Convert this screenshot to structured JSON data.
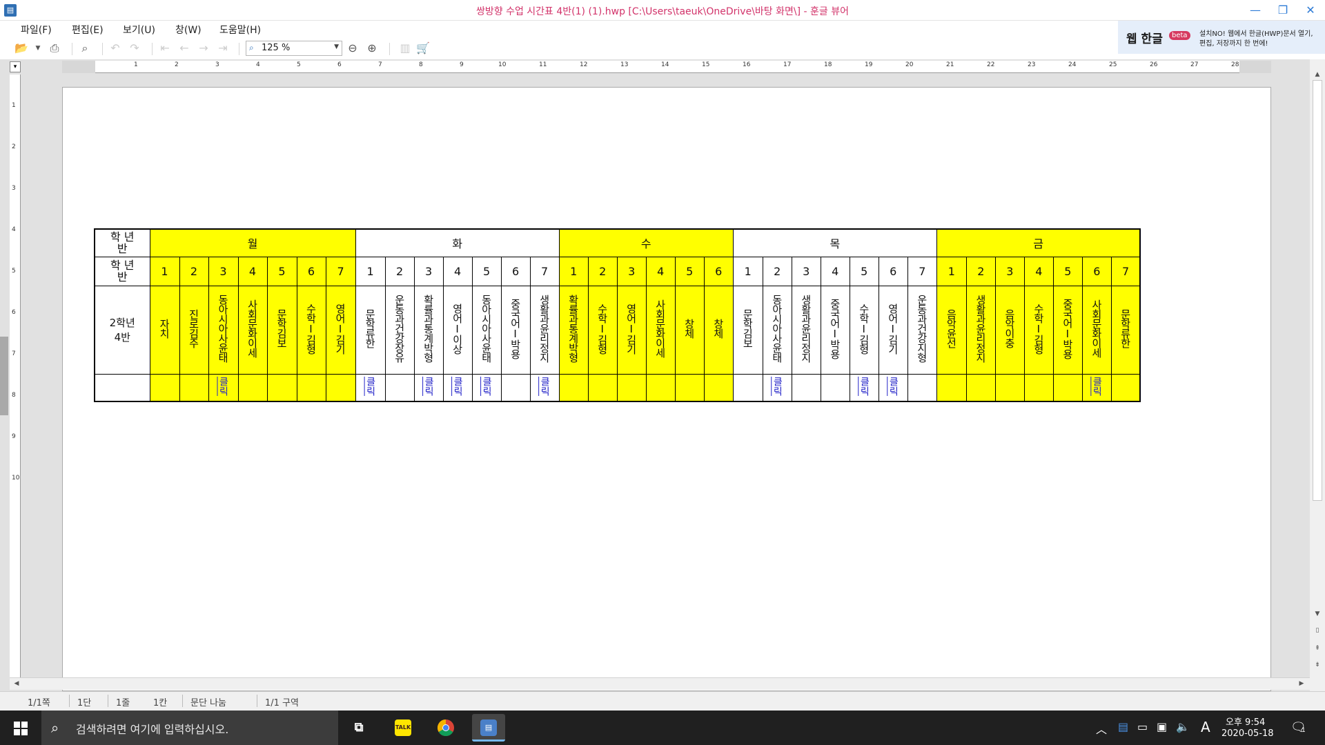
{
  "window": {
    "title": "쌍방향 수업 시간표 4반(1) (1).hwp [C:\\Users\\taeuk\\OneDrive\\바탕 화면\\] - 훈글 뷰어",
    "app_icon": "hwp-icon",
    "minimize": "—",
    "maximize": "❐",
    "close": "✕"
  },
  "menu": [
    "파일(F)",
    "편집(E)",
    "보기(U)",
    "창(W)",
    "도움말(H)"
  ],
  "toolbar": {
    "zoom": "125 %"
  },
  "promo": {
    "title": "웹 한글",
    "badge": "beta",
    "line1": "설치NO! 웹에서 한글(HWP)문서 열기,",
    "line2": "편집, 저장까지 한 번에!"
  },
  "ruler": {
    "h": [
      "1",
      "2",
      "3",
      "4",
      "5",
      "6",
      "7",
      "8",
      "9",
      "10",
      "11",
      "12",
      "13",
      "14",
      "15",
      "16",
      "17",
      "18",
      "19",
      "20",
      "21",
      "22",
      "23",
      "24",
      "25",
      "26",
      "27",
      "28"
    ],
    "v": [
      "1",
      "2",
      "3",
      "4",
      "5",
      "6",
      "7",
      "8",
      "9",
      "10"
    ]
  },
  "timetable": {
    "corner_label": "학 년\n반",
    "class_label": "2학년\n4반",
    "days": [
      {
        "name": "월",
        "color": "#ffff00",
        "periods": [
          "1",
          "2",
          "3",
          "4",
          "5",
          "6",
          "7"
        ],
        "subjects": [
          "자치",
          "진로김주",
          "동아시아사윤태",
          "사회문화이세",
          "문학김보",
          "수학I김형",
          "영어I김기"
        ],
        "links": [
          "",
          "",
          "클릭",
          "",
          "",
          "",
          ""
        ]
      },
      {
        "name": "화",
        "color": "#ffffff",
        "periods": [
          "1",
          "2",
          "3",
          "4",
          "5",
          "6",
          "7"
        ],
        "subjects": [
          "문학류한",
          "운동과건강장유",
          "확률과통계박형",
          "영어I이상",
          "동아시아사윤태",
          "중국어I박용",
          "생활과윤리정지"
        ],
        "links": [
          "클릭",
          "",
          "클릭",
          "클릭",
          "클릭",
          "",
          "클릭"
        ]
      },
      {
        "name": "수",
        "color": "#ffff00",
        "periods": [
          "1",
          "2",
          "3",
          "4",
          "5",
          "6"
        ],
        "subjects": [
          "확률과통계박형",
          "수학I김형",
          "영어I김기",
          "사회문화이세",
          "창체",
          "창체"
        ],
        "links": [
          "",
          "",
          "",
          "",
          "",
          ""
        ]
      },
      {
        "name": "목",
        "color": "#ffffff",
        "periods": [
          "1",
          "2",
          "3",
          "4",
          "5",
          "6",
          "7"
        ],
        "subjects": [
          "문학김보",
          "동아시아사윤태",
          "생활과윤리정지",
          "중국어I박용",
          "수학I김형",
          "영어I김기",
          "운동과건강지형"
        ],
        "links": [
          "",
          "클릭",
          "",
          "",
          "클릭",
          "클릭",
          ""
        ]
      },
      {
        "name": "금",
        "color": "#ffff00",
        "periods": [
          "1",
          "2",
          "3",
          "4",
          "5",
          "6",
          "7"
        ],
        "subjects": [
          "음악윤선",
          "생활과윤리정지",
          "음악이충",
          "수학I김형",
          "중국어I박용",
          "사회문화이세",
          "문학류한"
        ],
        "links": [
          "",
          "",
          "",
          "",
          "",
          "클릭",
          ""
        ]
      }
    ]
  },
  "status": {
    "page": "1/1쪽",
    "column": "1단",
    "line": "1줄",
    "col": "1칸",
    "paragraph": "문단 나눔",
    "section": "1/1 구역"
  },
  "taskbar": {
    "search_placeholder": "검색하려면 여기에 입력하십시오.",
    "apps": [
      "task-view-icon",
      "kakaotalk-icon",
      "chrome-icon",
      "hwp-viewer-icon"
    ],
    "kakao_label": "TALK",
    "ime": "A",
    "time": "오후 9:54",
    "date": "2020-05-18",
    "notification_count": "1"
  }
}
